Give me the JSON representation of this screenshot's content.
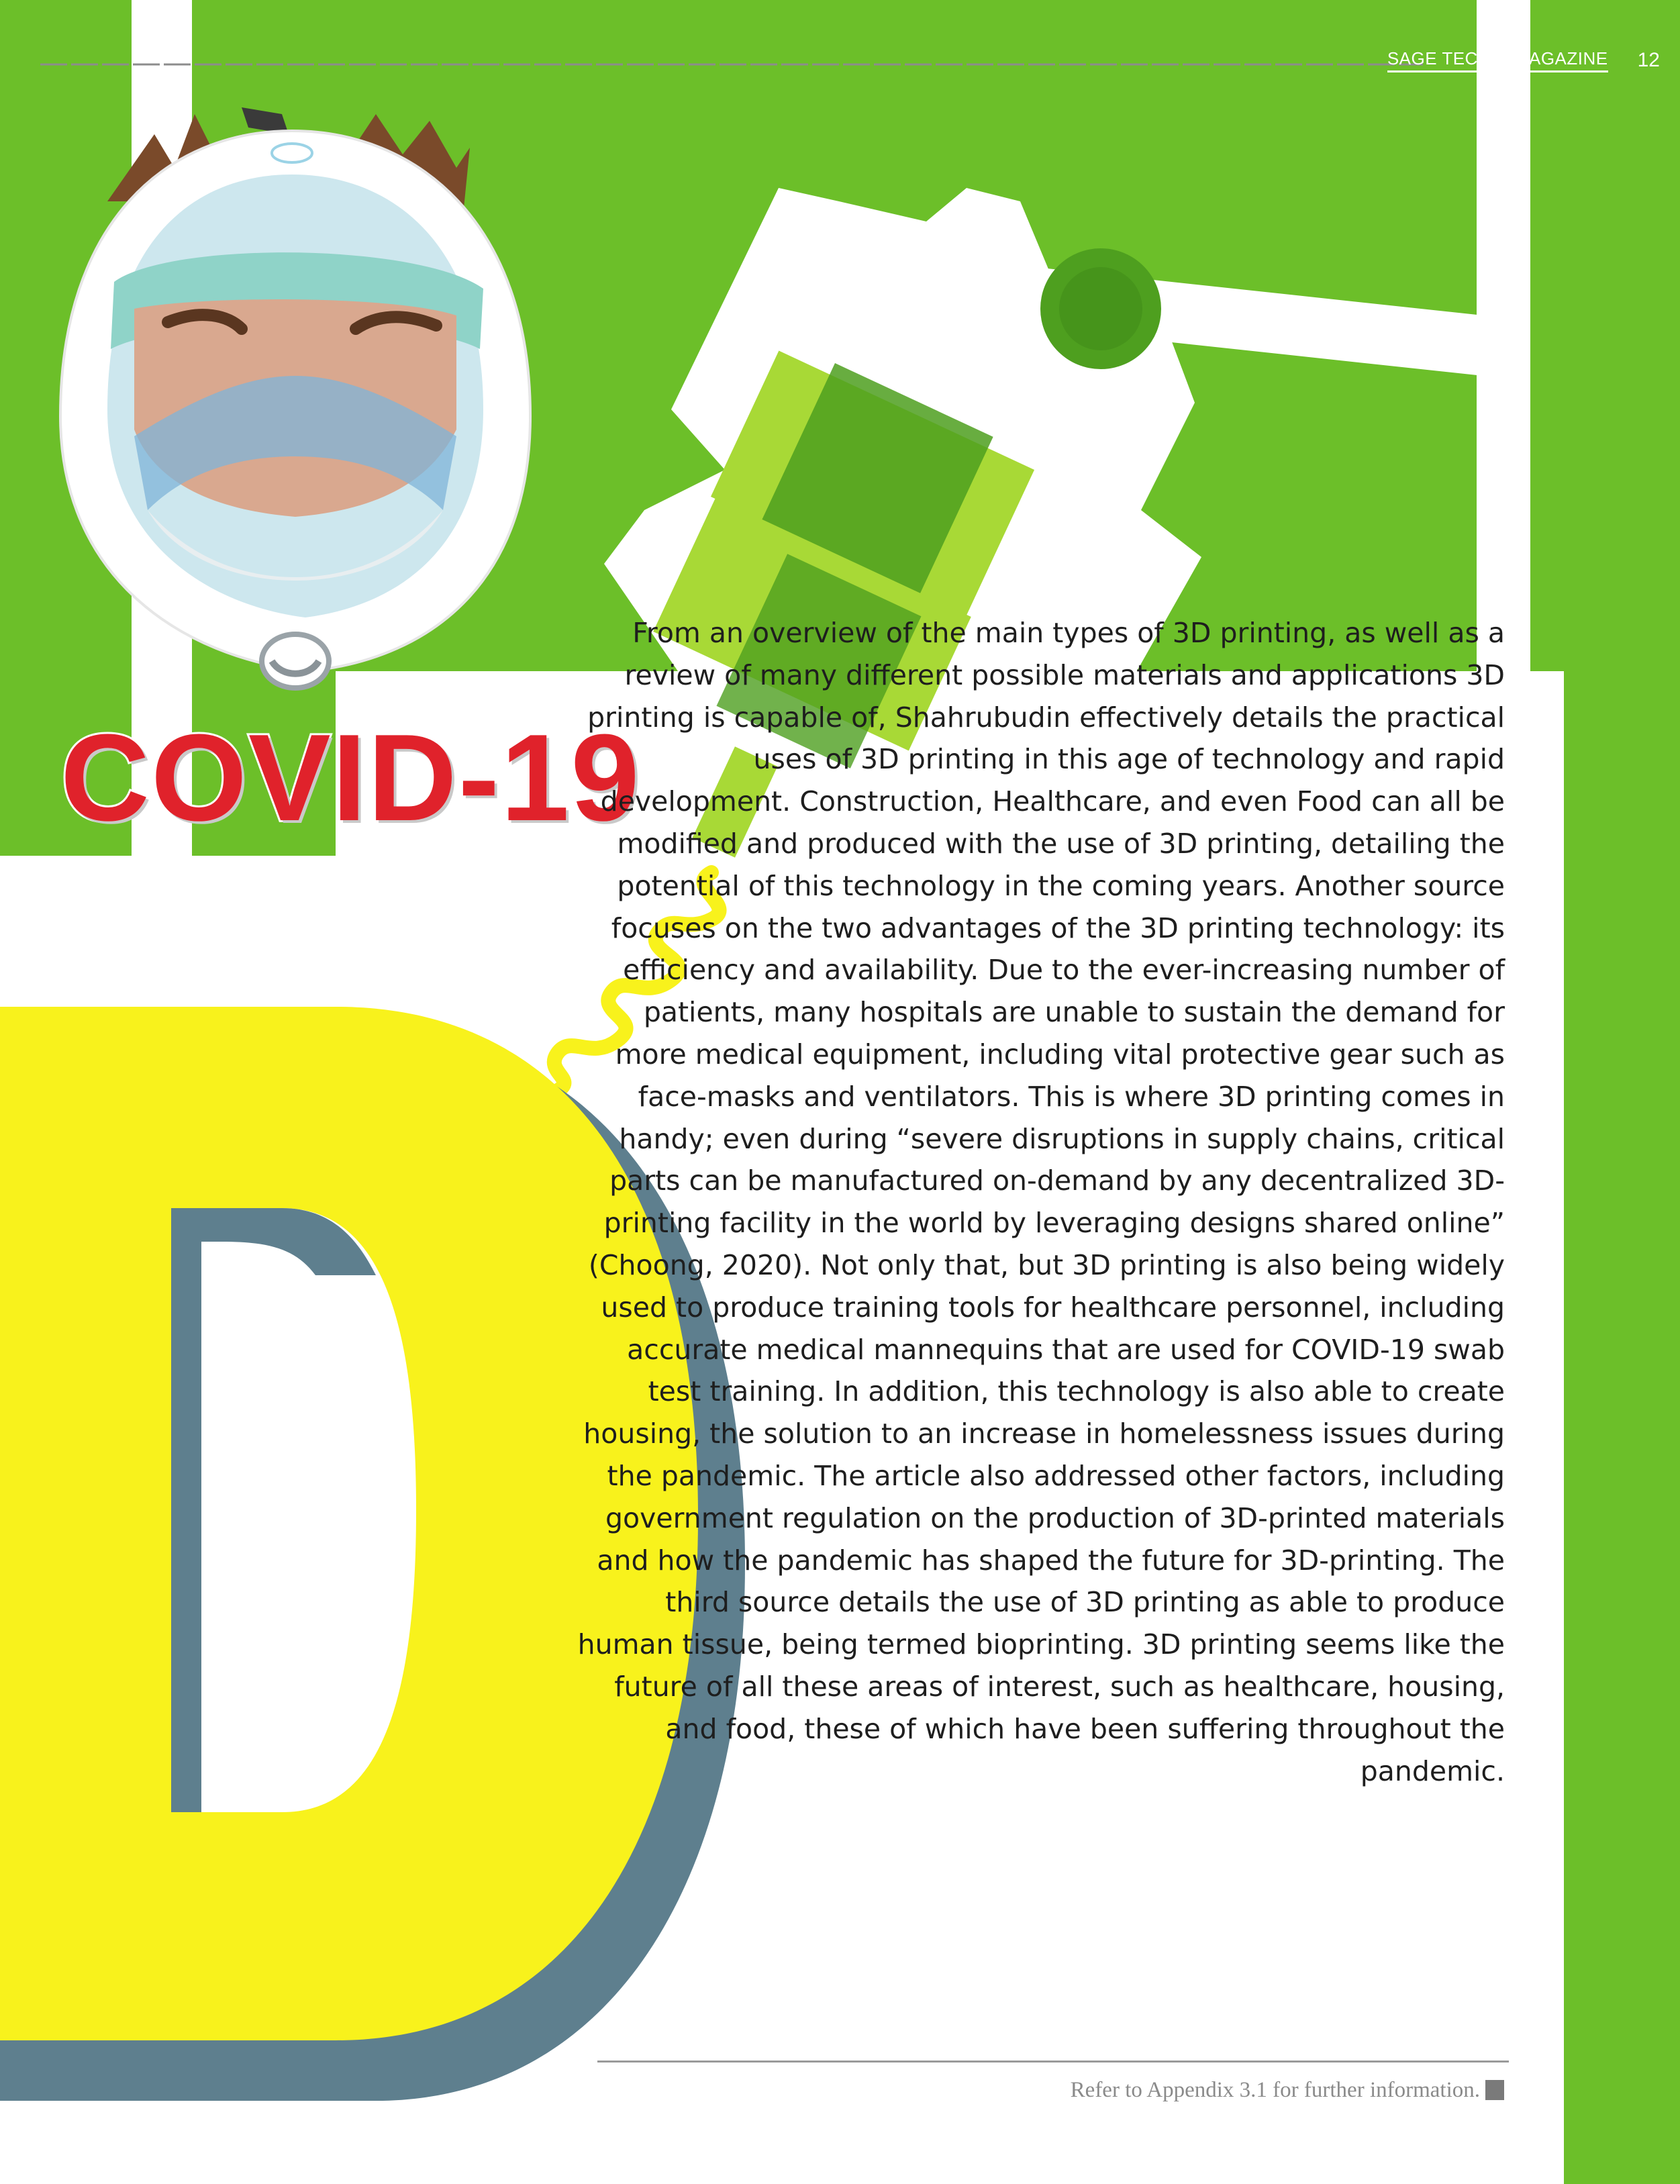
{
  "header": {
    "magazine": "SAGE TECH-X MAGAZINE",
    "page_number": "12"
  },
  "illustration": {
    "title": "COVID-19",
    "drop_cap": "D"
  },
  "article": {
    "body": "From an overview of the main types of 3D printing, as well as a review of many different possible materials and applications 3D printing is capable of, Shahrubudin effectively details the practical uses of 3D printing in this age of technology and rapid development. Construction, Healthcare, and even Food can all be modified and produced with the use of 3D printing, detailing the potential of this technology in the coming years. Another source focuses on the two advantages of the 3D printing technology: its efficiency and availability. Due to the ever-increasing number of patients, many hospitals are unable to sustain the demand for more medical equipment, including vital protective gear such as face-masks and ventilators. This is where 3D printing comes in handy; even during “severe disruptions in supply chains, critical parts can be manufactured on-demand by any decentralized 3D-printing facility in the world by leveraging designs shared online” (Choong, 2020). Not only that, but 3D printing is also being widely used to produce training tools for healthcare personnel, including accurate medical mannequins that are used for COVID-19 swab test training. In addition, this technology is also able to create housing, the solution to an increase in homelessness issues during the pandemic. The article also addressed other factors, including government regulation on the production of 3D-printed materials and how the pandemic has shaped the future for 3D-printing. The third source details the use of 3D printing as able to produce human tissue, being termed bioprinting. 3D printing seems like the future of all these areas of interest, such as healthcare, housing, and food, these of which have been suffering throughout the pandemic."
  },
  "footer": {
    "note": "Refer to Appendix 3.1 for further information."
  },
  "colors": {
    "green": "#6cbf29",
    "light_green": "#a8d936",
    "dark_green": "#4e9f1f",
    "yellow": "#f8f21c",
    "slate": "#5e7f8e",
    "red": "#e0222b"
  },
  "icons": [
    "diving-mask-face-icon",
    "3d-printer-arm-icon",
    "coil-cable-icon",
    "end-mark-icon"
  ]
}
